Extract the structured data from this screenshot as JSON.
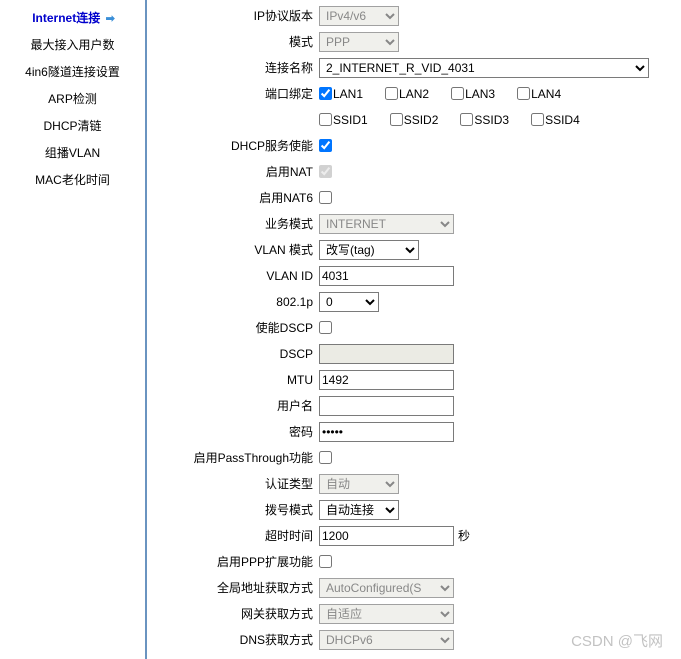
{
  "sidebar": {
    "items": [
      {
        "id": "internet-conn",
        "label": "Internet连接",
        "active": true
      },
      {
        "id": "max-users",
        "label": "最大接入用户数",
        "active": false
      },
      {
        "id": "4in6-tunnel",
        "label": "4in6隧道连接设置",
        "active": false
      },
      {
        "id": "arp-detect",
        "label": "ARP检测",
        "active": false
      },
      {
        "id": "dhcp-clear",
        "label": "DHCP清链",
        "active": false
      },
      {
        "id": "multicast-vlan",
        "label": "组播VLAN",
        "active": false
      },
      {
        "id": "mac-aging",
        "label": "MAC老化时间",
        "active": false
      }
    ]
  },
  "form": {
    "ip_ver_label": "IP协议版本",
    "ip_ver_value": "IPv4/v6",
    "mode_label": "模式",
    "mode_value": "PPP",
    "conn_name_label": "连接名称",
    "conn_name_value": "2_INTERNET_R_VID_4031",
    "port_bind_label": "端口绑定",
    "port_bind_row1": [
      {
        "id": "lan1",
        "label": "LAN1",
        "checked": true
      },
      {
        "id": "lan2",
        "label": "LAN2",
        "checked": false
      },
      {
        "id": "lan3",
        "label": "LAN3",
        "checked": false
      },
      {
        "id": "lan4",
        "label": "LAN4",
        "checked": false
      }
    ],
    "port_bind_row2": [
      {
        "id": "ssid1",
        "label": "SSID1",
        "checked": false
      },
      {
        "id": "ssid2",
        "label": "SSID2",
        "checked": false
      },
      {
        "id": "ssid3",
        "label": "SSID3",
        "checked": false
      },
      {
        "id": "ssid4",
        "label": "SSID4",
        "checked": false
      }
    ],
    "dhcp_enable_label": "DHCP服务使能",
    "dhcp_enable_checked": true,
    "nat_label": "启用NAT",
    "nat_checked": true,
    "nat6_label": "启用NAT6",
    "nat6_checked": false,
    "biz_mode_label": "业务模式",
    "biz_mode_value": "INTERNET",
    "vlan_mode_label": "VLAN 模式",
    "vlan_mode_value": "改写(tag)",
    "vlan_id_label": "VLAN ID",
    "vlan_id_value": "4031",
    "p8021_label": "802.1p",
    "p8021_value": "0",
    "dscp_enable_label": "使能DSCP",
    "dscp_enable_checked": false,
    "dscp_label": "DSCP",
    "dscp_value": "",
    "mtu_label": "MTU",
    "mtu_value": "1492",
    "user_label": "用户名",
    "user_value": "",
    "pass_label": "密码",
    "pass_value": "•••••",
    "passthrough_label": "启用PassThrough功能",
    "passthrough_checked": false,
    "auth_type_label": "认证类型",
    "auth_type_value": "自动",
    "dial_mode_label": "拨号模式",
    "dial_mode_value": "自动连接",
    "timeout_label": "超时时间",
    "timeout_value": "1200",
    "timeout_unit": "秒",
    "ppp_ext_label": "启用PPP扩展功能",
    "ppp_ext_checked": false,
    "global_addr_label": "全局地址获取方式",
    "global_addr_value": "AutoConfigured(S",
    "gw_label": "网关获取方式",
    "gw_value": "自适应",
    "dns_label": "DNS获取方式",
    "dns_value": "DHCPv6"
  },
  "watermark": "CSDN @飞网"
}
